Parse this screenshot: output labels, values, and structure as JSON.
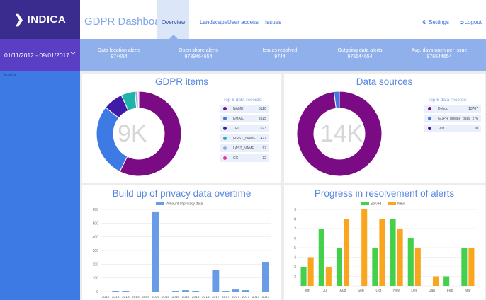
{
  "app": {
    "logo": "INDICA",
    "brand": "GDPR Dashboard"
  },
  "nav": {
    "tabs": [
      "Overview",
      "Landscape",
      "User access",
      "Issues"
    ],
    "settings": "Settings",
    "logout": "Logout"
  },
  "sidebar": {
    "date_range": "01/11/2012 - 09/01/2017",
    "note": "testing"
  },
  "stats": [
    {
      "label": "Data location alerts",
      "value": "974654"
    },
    {
      "label": "Open share alerts",
      "value": "9789464654"
    },
    {
      "label": "Issues resolved",
      "value": "9744"
    },
    {
      "label": "Outgoing data alerts",
      "value": "976544654"
    },
    {
      "label": "Avg. days open per issue",
      "value": "976544654"
    }
  ],
  "colors": {
    "accent": "#3d7ae3",
    "purple": "#7b0a85",
    "blue": "#3d7ae3",
    "green": "#44d04a",
    "orange": "#f9a51e"
  },
  "gdpr": {
    "title": "GDPR items",
    "center": "9K",
    "legend_title": "Top 6 data records:",
    "items": [
      {
        "name": "NAME",
        "value": "5120",
        "color": "#7b0a85"
      },
      {
        "name": "EMAIL",
        "value": "2515",
        "color": "#3d7ae3"
      },
      {
        "name": "TEL",
        "value": "673",
        "color": "#3f1ba6"
      },
      {
        "name": "FIRST_NAME",
        "value": "477",
        "color": "#20b3a8"
      },
      {
        "name": "LAST_NAME",
        "value": "97",
        "color": "#a3a3e8"
      },
      {
        "name": "CC",
        "value": "32",
        "color": "#e0339a"
      }
    ]
  },
  "sources": {
    "title": "Data sources",
    "center": "14K",
    "legend_title": "Top 6 data records:",
    "items": [
      {
        "name": "Debug",
        "value": "13707",
        "color": "#7b0a85"
      },
      {
        "name": "GDPR_private_data",
        "value": "276",
        "color": "#3d7ae3"
      },
      {
        "name": "Test",
        "value": "10",
        "color": "#3f1ba6"
      }
    ]
  },
  "chart_data": [
    {
      "type": "bar",
      "title": "Build up of privacy data overtime",
      "categories": [
        "2012",
        "2012",
        "2013",
        "2014",
        "2015",
        "2015",
        "2015",
        "2016",
        "2016",
        "2016",
        "2016",
        "2017",
        "2017",
        "2017",
        "2017",
        "2017",
        "2017"
      ],
      "series": [
        {
          "name": "Amount of privacy data",
          "color": "#6a9be6",
          "values": [
            0,
            5,
            5,
            0,
            0,
            585,
            0,
            5,
            10,
            5,
            0,
            160,
            5,
            15,
            10,
            0,
            215
          ]
        }
      ],
      "ylim": [
        0,
        600
      ],
      "yticks": [
        0,
        100,
        200,
        300,
        400,
        500,
        600
      ],
      "legend": "top"
    },
    {
      "type": "bar",
      "title": "Progress in resolvement of alerts",
      "categories": [
        "Jun",
        "Jul",
        "Aug",
        "Sep",
        "Oct",
        "Nov",
        "Dec",
        "Jan",
        "Feb",
        "Mar"
      ],
      "series": [
        {
          "name": "Solved",
          "color": "#44d04a",
          "values": [
            3,
            4,
            7,
            3,
            5,
            8,
            0,
            9,
            5,
            8,
            8,
            7,
            6,
            5,
            0,
            2,
            2,
            0,
            5,
            5
          ]
        },
        {
          "name": "New",
          "color": "#f9a51e",
          "values": [
            0,
            0,
            0,
            0,
            0,
            0,
            0,
            0,
            0,
            0,
            0,
            0,
            0,
            0,
            0,
            0,
            0,
            0,
            0,
            0
          ]
        }
      ],
      "pairs": [
        {
          "solved": 3,
          "new": 4
        },
        {
          "solved": 7,
          "new": 3
        },
        {
          "solved": 5,
          "new": 8
        },
        {
          "solved": 0,
          "new": 9
        },
        {
          "solved": 5,
          "new": 8
        },
        {
          "solved": 8,
          "new": 7
        },
        {
          "solved": 6,
          "new": 5
        },
        {
          "solved": 0,
          "new": 2
        },
        {
          "solved": 2,
          "new": 0
        },
        {
          "solved": 5,
          "new": 5
        }
      ],
      "ylim": [
        1,
        9
      ],
      "yticks": [
        1,
        2,
        3,
        4,
        5,
        6,
        7,
        8,
        9
      ],
      "legend": "top"
    }
  ]
}
